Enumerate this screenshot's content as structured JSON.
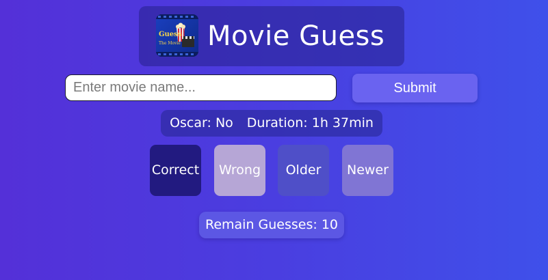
{
  "header": {
    "title": "Movie Guess",
    "logo_text_line1": "Guess",
    "logo_text_line2": "The Movie"
  },
  "search": {
    "placeholder": "Enter movie name...",
    "value": ""
  },
  "submit_label": "Submit",
  "hints": {
    "oscar": "Oscar: No",
    "duration": "Duration: 1h 37min"
  },
  "legend": [
    {
      "label": "Correct",
      "color": "#221a80"
    },
    {
      "label": "Wrong",
      "color": "#b6a6d6"
    },
    {
      "label": "Older",
      "color": "#4f4fc8"
    },
    {
      "label": "Newer",
      "color": "#8075d4"
    }
  ],
  "remaining": "Remain Guesses: 10",
  "colors": {
    "background_start": "#5430d8",
    "background_end": "#3f50ea",
    "submit_button": "#6a63f0"
  }
}
